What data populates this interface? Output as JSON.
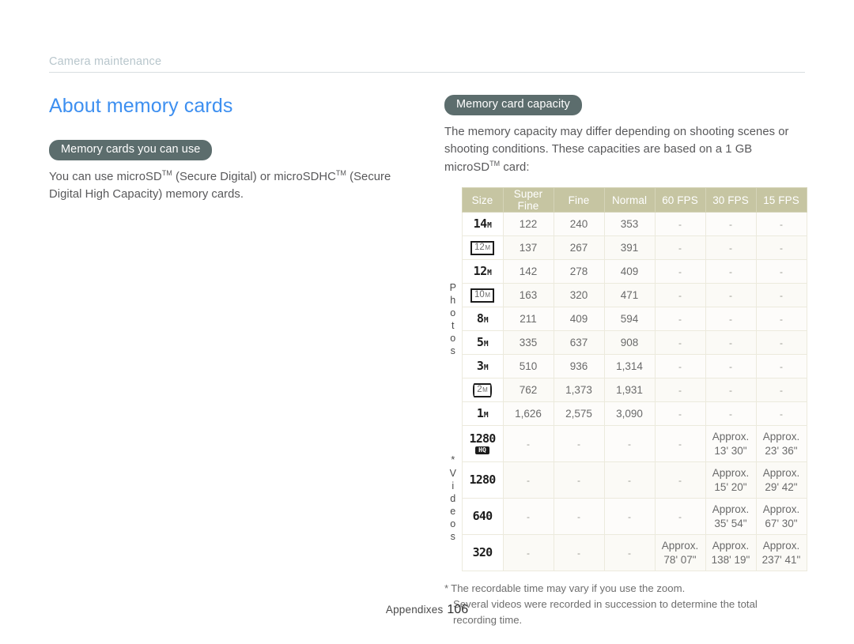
{
  "running_head": {
    "text": "Camera maintenance"
  },
  "page_title": "About memory cards",
  "left_column": {
    "section_pill": "Memory cards you can use",
    "paragraph_1": "You can use microSD",
    "paragraph_tm1": "TM",
    "paragraph_2": " (Secure Digital) or microSDHC",
    "paragraph_tm2": "TM",
    "paragraph_3": " (Secure Digital High Capacity) memory cards."
  },
  "right_column": {
    "section_pill": "Memory card capacity",
    "intro_1": "The memory capacity may differ depending on shooting scenes or shooting conditions. These capacities are based on a 1 GB microSD",
    "intro_tm": "TM",
    "intro_2": " card:"
  },
  "chart_data": {
    "type": "table",
    "title": "Memory card capacity",
    "columns": [
      "Size",
      "Super Fine",
      "Fine",
      "Normal",
      "60 FPS",
      "30 FPS",
      "15 FPS"
    ],
    "group_labels": {
      "photos": "Photos",
      "videos": "Videos",
      "videos_marker": "*"
    },
    "photos": [
      {
        "icon": "14m",
        "icon_style": "plain",
        "num": "14",
        "sub": "M",
        "super_fine": "122",
        "fine": "240",
        "normal": "353",
        "fps60": "-",
        "fps30": "-",
        "fps15": "-"
      },
      {
        "icon": "12m-corner",
        "icon_style": "corner",
        "num": "12",
        "sub": "M",
        "super_fine": "137",
        "fine": "267",
        "normal": "391",
        "fps60": "-",
        "fps30": "-",
        "fps15": "-"
      },
      {
        "icon": "12m",
        "icon_style": "plain",
        "num": "12",
        "sub": "M",
        "super_fine": "142",
        "fine": "278",
        "normal": "409",
        "fps60": "-",
        "fps30": "-",
        "fps15": "-"
      },
      {
        "icon": "10m-box",
        "icon_style": "box",
        "num": "10",
        "sub": "M",
        "super_fine": "163",
        "fine": "320",
        "normal": "471",
        "fps60": "-",
        "fps30": "-",
        "fps15": "-"
      },
      {
        "icon": "8m",
        "icon_style": "plain",
        "num": "8",
        "sub": "M",
        "super_fine": "211",
        "fine": "409",
        "normal": "594",
        "fps60": "-",
        "fps30": "-",
        "fps15": "-"
      },
      {
        "icon": "5m",
        "icon_style": "plain",
        "num": "5",
        "sub": "M",
        "super_fine": "335",
        "fine": "637",
        "normal": "908",
        "fps60": "-",
        "fps30": "-",
        "fps15": "-"
      },
      {
        "icon": "3m",
        "icon_style": "plain",
        "num": "3",
        "sub": "M",
        "super_fine": "510",
        "fine": "936",
        "normal": "1,314",
        "fps60": "-",
        "fps30": "-",
        "fps15": "-"
      },
      {
        "icon": "2m-wide",
        "icon_style": "wide",
        "num": "2",
        "sub": "M",
        "super_fine": "762",
        "fine": "1,373",
        "normal": "1,931",
        "fps60": "-",
        "fps30": "-",
        "fps15": "-"
      },
      {
        "icon": "1m",
        "icon_style": "plain",
        "num": "1",
        "sub": "M",
        "super_fine": "1,626",
        "fine": "2,575",
        "normal": "3,090",
        "fps60": "-",
        "fps30": "-",
        "fps15": "-"
      }
    ],
    "videos": [
      {
        "icon": "1280-hq",
        "icon_style": "hq",
        "num": "1280",
        "badge": "HQ",
        "super_fine": "-",
        "fine": "-",
        "normal": "-",
        "fps60": "-",
        "fps30_word": "Approx.",
        "fps30_time": "13' 30\"",
        "fps15_word": "Approx.",
        "fps15_time": "23' 36\""
      },
      {
        "icon": "1280",
        "icon_style": "vid",
        "num": "1280",
        "super_fine": "-",
        "fine": "-",
        "normal": "-",
        "fps60": "-",
        "fps30_word": "Approx.",
        "fps30_time": "15' 20\"",
        "fps15_word": "Approx.",
        "fps15_time": "29' 42\""
      },
      {
        "icon": "640",
        "icon_style": "vid",
        "num": "640",
        "super_fine": "-",
        "fine": "-",
        "normal": "-",
        "fps60": "-",
        "fps30_word": "Approx.",
        "fps30_time": "35' 54\"",
        "fps15_word": "Approx.",
        "fps15_time": "67' 30\""
      },
      {
        "icon": "320",
        "icon_style": "vid",
        "num": "320",
        "super_fine": "-",
        "fine": "-",
        "normal": "-",
        "fps60_word": "Approx.",
        "fps60_time": "78' 07\"",
        "fps30_word": "Approx.",
        "fps30_time": "138' 19\"",
        "fps15_word": "Approx.",
        "fps15_time": "237' 41\""
      }
    ],
    "header_bg": "#c6c5a2",
    "cell_bg": "#fdfcfa",
    "border_color": "#eceadd"
  },
  "footnote": {
    "star": "*",
    "line1": "The recordable time may vary if you use the zoom.",
    "line2": "Several videos were recorded in succession to determine the total",
    "line3": "recording time."
  },
  "footer": {
    "label": "Appendixes",
    "page": "106"
  },
  "colors": {
    "title_blue": "#3d8ff0",
    "pill_bg": "#5c6d6d",
    "running_head": "#b8c6cc"
  }
}
